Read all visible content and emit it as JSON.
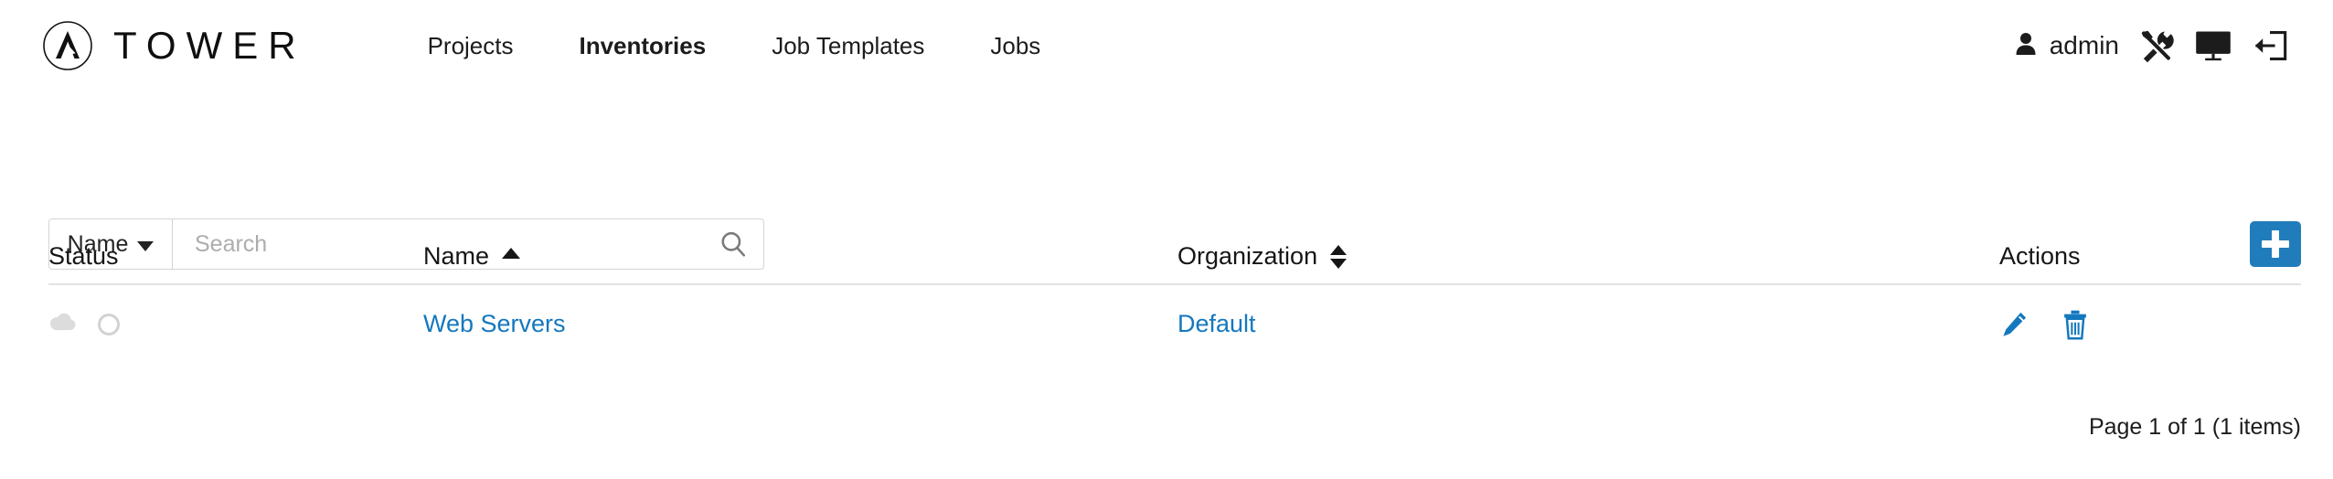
{
  "app": {
    "brand_name": "TOWER",
    "logo_icon": "ansible-circle-logo"
  },
  "nav": {
    "items": [
      {
        "label": "Projects",
        "active": false
      },
      {
        "label": "Inventories",
        "active": true
      },
      {
        "label": "Job Templates",
        "active": false
      },
      {
        "label": "Jobs",
        "active": false
      }
    ]
  },
  "user_nav": {
    "user_icon": "user-icon",
    "username": "admin",
    "icons": [
      {
        "name": "tools-icon"
      },
      {
        "name": "monitor-icon"
      },
      {
        "name": "logout-icon"
      }
    ]
  },
  "toolbar": {
    "search_key_label": "Name",
    "search_key_caret": "chevron-down-icon",
    "search_placeholder": "Search",
    "search_value": "",
    "search_submit_icon": "search-icon",
    "add_button_icon": "plus-icon",
    "add_button_color": "#217cbb"
  },
  "table": {
    "columns": [
      {
        "key": "status",
        "label": "Status",
        "sort": "none"
      },
      {
        "key": "name",
        "label": "Name",
        "sort": "asc"
      },
      {
        "key": "organization",
        "label": "Organization",
        "sort": "both"
      },
      {
        "key": "actions",
        "label": "Actions",
        "sort": "none"
      }
    ],
    "rows": [
      {
        "status_icons": [
          "cloud-icon",
          "status-circle-icon"
        ],
        "name": "Web Servers",
        "organization": "Default",
        "actions": [
          "edit-pencil-icon",
          "delete-trash-icon"
        ]
      }
    ]
  },
  "footer": {
    "pagination": "Page 1 of 1 (1 items)"
  },
  "colors": {
    "link": "#1478be",
    "accent": "#217cbb",
    "text": "#1f1f1f",
    "muted": "#adadad",
    "divider": "#e3e3e3"
  }
}
